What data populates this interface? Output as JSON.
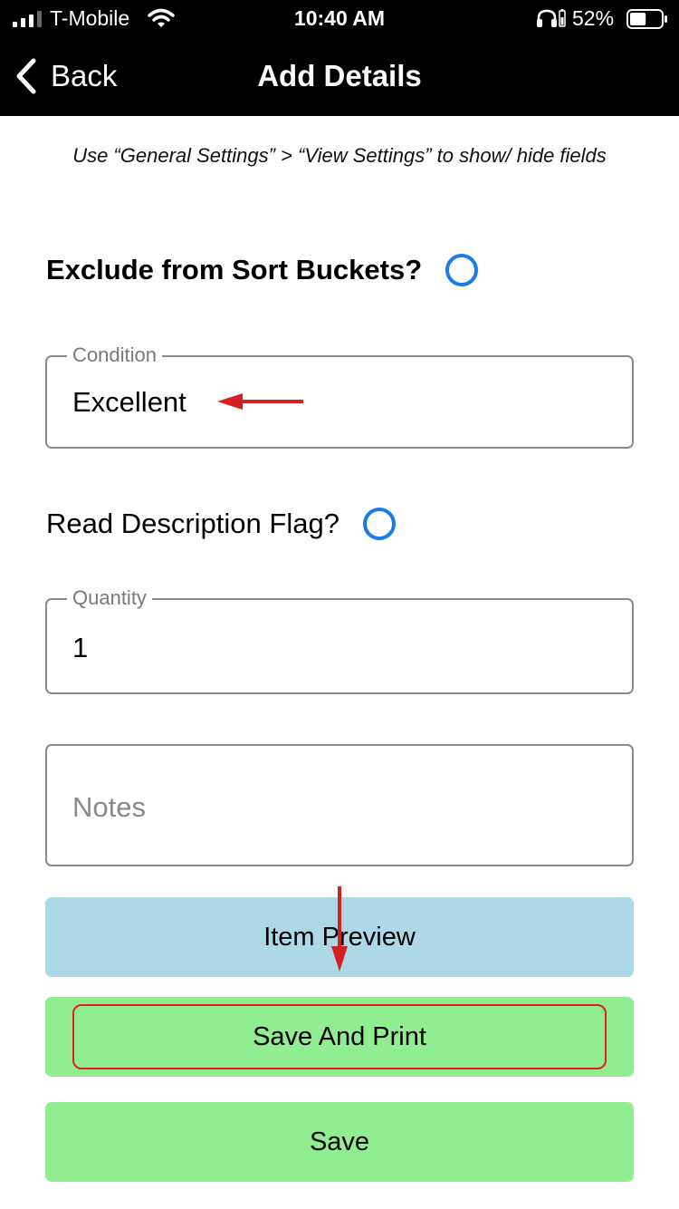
{
  "status_bar": {
    "carrier": "T-Mobile",
    "time": "10:40 AM",
    "battery_percent": "52%",
    "battery_level": 0.52
  },
  "nav": {
    "back_label": "Back",
    "title": "Add Details"
  },
  "hint": "Use “General Settings” > “View Settings” to show/ hide fields",
  "exclude_toggle": {
    "label": "Exclude from Sort Buckets?",
    "checked": false
  },
  "condition": {
    "label": "Condition",
    "value": "Excellent"
  },
  "read_description_toggle": {
    "label": "Read Description Flag?",
    "checked": false
  },
  "quantity": {
    "label": "Quantity",
    "value": "1"
  },
  "notes": {
    "placeholder": "Notes",
    "value": ""
  },
  "buttons": {
    "item_preview": "Item Preview",
    "save_and_print": "Save And Print",
    "save": "Save"
  },
  "colors": {
    "nav_background": "#000000",
    "radio_blue": "#1b7be8",
    "preview_button": "#add8e6",
    "save_button": "#90ee90",
    "annotation_red": "#e0201b"
  },
  "icons": {
    "back": "chevron-left-icon",
    "signal": "cellular-signal-icon",
    "wifi": "wifi-icon",
    "headphones": "headphones-icon",
    "battery": "battery-icon"
  }
}
